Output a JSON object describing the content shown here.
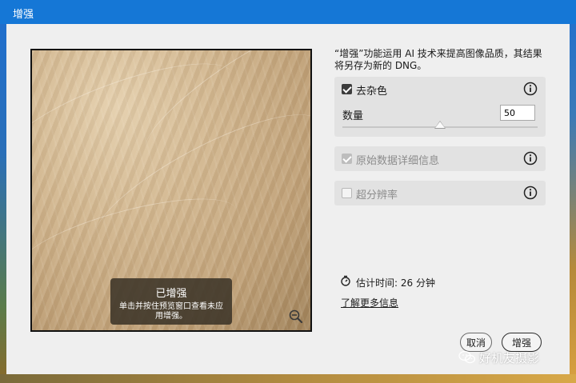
{
  "window": {
    "title": "增强"
  },
  "preview": {
    "overlay_title": "已增强",
    "overlay_text": "单击并按住预览窗口查看未应用增强。",
    "zoom_icon": "zoom-out-icon"
  },
  "description": "“增强”功能运用 AI 技术来提高图像品质，其结果将另存为新的 DNG。",
  "options": {
    "denoise": {
      "label": "去杂色",
      "checked": true,
      "enabled": true,
      "info_icon": "info-icon"
    },
    "amount": {
      "label": "数量",
      "value": "50",
      "slider_percent": 50
    },
    "raw_details": {
      "label": "原始数据详细信息",
      "checked": true,
      "enabled": false,
      "info_icon": "info-icon"
    },
    "super_resolution": {
      "label": "超分辨率",
      "checked": false,
      "enabled": false,
      "info_icon": "info-icon"
    }
  },
  "estimate": {
    "icon": "stopwatch-icon",
    "text": "估计时间: 26 分钟"
  },
  "learn_more": "了解更多信息",
  "buttons": {
    "cancel": "取消",
    "enhance": "增强"
  },
  "watermark": {
    "text": "好机友摄影",
    "icon": "wechat-icon"
  },
  "colors": {
    "titlebar": "#1577d6",
    "dialog_bg": "#efefef",
    "panel_bg": "#e2e2e2"
  }
}
